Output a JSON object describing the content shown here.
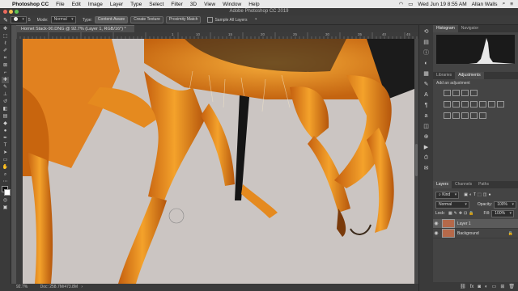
{
  "menubar": {
    "apple": "",
    "app": "Photoshop CC",
    "items": [
      "File",
      "Edit",
      "Image",
      "Layer",
      "Type",
      "Select",
      "Filter",
      "3D",
      "View",
      "Window",
      "Help"
    ],
    "datetime": "Wed Jun 19  8:55 AM",
    "user": "Allan Walls"
  },
  "titlebar": {
    "title": "Adobe Photoshop CC 2019"
  },
  "options": {
    "size": "5",
    "mode_label": "Mode:",
    "mode_value": "Normal",
    "type_label": "Type:",
    "btn_content_aware": "Content-Aware",
    "btn_create_texture": "Create Texture",
    "btn_proximity_match": "Proximity Match",
    "sample_all_layers": "Sample All Layers"
  },
  "document": {
    "tab_title": "Hornet Stack-90.DNG @ 92.7% (Layer 1, RGB/16*) *",
    "ruler_marks": [
      "1",
      "10",
      "15",
      "20",
      "25",
      "30",
      "35",
      "40",
      "45"
    ]
  },
  "status": {
    "zoom": "92.7%",
    "doc": "Doc: 258.7M/473.8M"
  },
  "panels": {
    "top_tabs": [
      "Histogram",
      "Navigator"
    ],
    "adj_tabs": [
      "Libraries",
      "Adjustments"
    ],
    "add_adjustment": "Add an adjustment",
    "layer_tabs": [
      "Layers",
      "Channels",
      "Paths"
    ],
    "kind_label": "Kind",
    "blend_mode": "Normal",
    "opacity_label": "Opacity:",
    "opacity_value": "100%",
    "lock_label": "Lock:",
    "fill_label": "Fill:",
    "fill_value": "100%",
    "layers": [
      {
        "name": "Layer 1",
        "selected": true
      },
      {
        "name": "Background",
        "selected": false
      }
    ],
    "bottom_icons": [
      "link-icon",
      "fx-icon",
      "mask-icon",
      "adjustment-icon",
      "folder-icon",
      "new-layer-icon",
      "trash-icon"
    ]
  },
  "colors": {
    "ui_dark": "#3a3a3a",
    "panel": "#444444",
    "canvas_bg": "#c9c3c0",
    "hornet_orange": "#e58a1f",
    "hornet_dark": "#8a4b12"
  }
}
